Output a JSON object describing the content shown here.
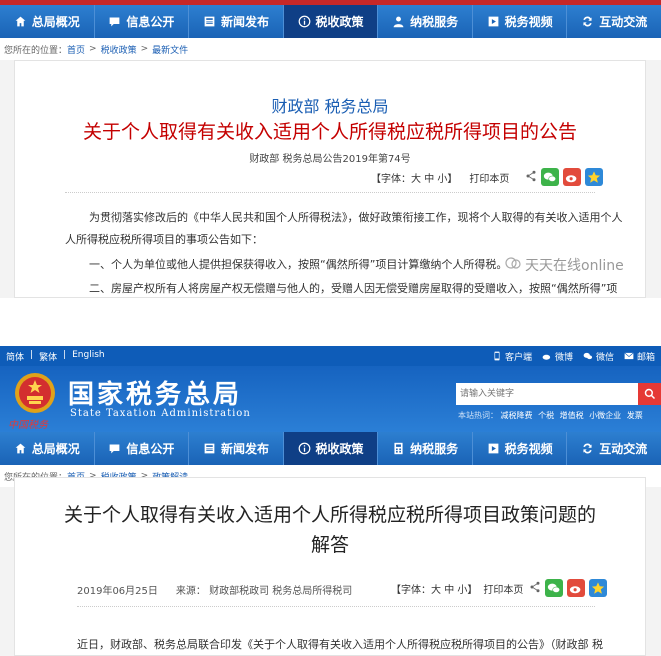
{
  "nav": {
    "items": [
      {
        "label": "总局概况",
        "icon": "home-icon"
      },
      {
        "label": "信息公开",
        "icon": "chat-icon"
      },
      {
        "label": "新闻发布",
        "icon": "news-icon"
      },
      {
        "label": "税收政策",
        "icon": "info-icon",
        "active": true
      },
      {
        "label": "纳税服务",
        "icon": "person-icon"
      },
      {
        "label": "税务视频",
        "icon": "video-icon"
      },
      {
        "label": "互动交流",
        "icon": "exchange-icon"
      }
    ]
  },
  "panel1": {
    "breadcrumb": {
      "prefix": "您所在的位置：",
      "items": [
        "首页",
        "税收政策",
        "最新文件"
      ]
    },
    "issuer": "财政部 税务总局",
    "title": "关于个人取得有关收入适用个人所得税应税所得项目的公告",
    "doc_number": "财政部 税务总局公告2019年第74号",
    "font_label": "【字体：",
    "font_large": "大",
    "font_medium": "中",
    "font_small": "小",
    "font_end": "】",
    "print": "打印本页",
    "paragraphs": [
      "为贯彻落实修改后的《中华人民共和国个人所得税法》，做好政策衔接工作，现将个人取得的有关收入适用个人",
      "人所得税应税所得项目的事项公告如下：",
      "一、个人为单位或他人提供担保获得收入，按照“偶然所得”项目计算缴纳个人所得税。",
      "二、房屋产权所有人将房屋产权无偿赠与他人的，受赠人因无偿受赠房屋取得的受赠收入，按照“偶然所得”项"
    ],
    "watermark": "天天在线online"
  },
  "panel2": {
    "utility_left": [
      "简体",
      "|",
      "繁体",
      "|",
      "English"
    ],
    "utility_right": [
      {
        "label": "客户端",
        "icon": "mobile-icon"
      },
      {
        "label": "微博",
        "icon": "weibo-icon"
      },
      {
        "label": "微信",
        "icon": "wechat-icon"
      },
      {
        "label": "邮箱",
        "icon": "mail-icon"
      }
    ],
    "site_title": "国家税务总局",
    "site_subtitle": "State Taxation Administration",
    "calligraphy": "中国税务",
    "search_placeholder": "请输入关键字",
    "hot_label": "本站热词：",
    "hot_words": [
      "减税降费",
      "个税",
      "增值税",
      "小微企业",
      "发票"
    ],
    "breadcrumb": {
      "prefix": "您所在的位置：",
      "items": [
        "首页",
        "税收政策",
        "政策解读"
      ]
    },
    "title_line1": "关于个人取得有关收入适用个人所得税应税所得项目政策问题的",
    "title_line2": "解答",
    "date": "2019年06月25日",
    "source_label": "来源：",
    "source": "财政部税政司  税务总局所得税司",
    "font_label": "【字体：",
    "font_large": "大",
    "font_medium": "中",
    "font_small": "小",
    "font_end": "】",
    "print": "打印本页",
    "paragraph": "近日，财政部、税务总局联合印发《关于个人取得有关收入适用个人所得税应税所得项目的公告》（财政部 税"
  }
}
